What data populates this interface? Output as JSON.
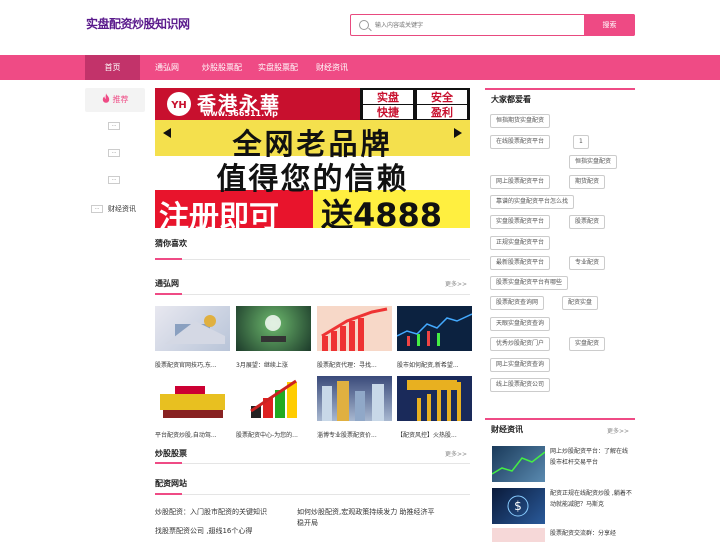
{
  "site": {
    "title": "实盘配资炒股知识网"
  },
  "search": {
    "placeholder": "输入内容或关键字",
    "button": "搜索"
  },
  "nav": [
    {
      "label": "首页"
    },
    {
      "label": "通弘网"
    },
    {
      "label": "炒股股票配"
    },
    {
      "label": "实盘股票配"
    },
    {
      "label": "财经资讯"
    }
  ],
  "sidebar": {
    "recommend": "推荐",
    "dots": "···",
    "category": "财经资讯"
  },
  "banner": {
    "brand_en": "www.366511.vip",
    "brand_cn": "香港永華",
    "badge1": "实盘",
    "badge2": "安全",
    "badge3": "快捷",
    "badge4": "盈利",
    "line1": "全网老品牌",
    "line2": "值得您的信赖",
    "line3": "注册即可",
    "line4": "送4888"
  },
  "sections": {
    "guess": "猜你喜欢",
    "tonghong": "通弘网",
    "more": "更多>>",
    "chaogu": "炒股股票",
    "peizi": "配资网站"
  },
  "thumbs": [
    {
      "caption": "股票配资官网技巧,东..."
    },
    {
      "caption": "3月展望：继续上涨"
    },
    {
      "caption": "股票配资代理：寻找..."
    },
    {
      "caption": "股市如何配资,新希望..."
    },
    {
      "caption": "平台配资炒股,自动驾..."
    },
    {
      "caption": "股票配资中心-为您的..."
    },
    {
      "caption": "淄博专业股票配资价..."
    },
    {
      "caption": "【配资风控】火热股..."
    }
  ],
  "articles": [
    {
      "title": "炒股配资：入门股市配资的关键知识"
    },
    {
      "title": "如何炒股配资,宏观政策持续发力 助推经济平稳开局"
    },
    {
      "title": "找股票配资公司 ,翅线16个心得"
    }
  ],
  "popular": {
    "title": "大家都爱看",
    "tags": [
      "恒指期货实盘配资",
      "在线股票配资平台",
      "1",
      "恒指实盘配资",
      "网上股票配资平台",
      "期货配资",
      "靠谱的实盘配资平台怎么找",
      "实盘股票配资平台",
      "股票配资",
      "正规实盘配资平台",
      "最新股票配资平台",
      "专业配资",
      "股票实盘配资平台有哪些",
      "股票配资查询网",
      "配资实盘",
      "天眼实盘配资查询",
      "优秀炒股配资门户",
      "实盘配资",
      "网上实盘配资查询",
      "线上股票配资公司"
    ]
  },
  "finance": {
    "title": "财经资讯",
    "more": "更多>>",
    "items": [
      {
        "title": "网上炒股配资平台：了解在线股市杠杆交易平台"
      },
      {
        "title": "配资正规在线配资炒股 ,躺着不动就能减肥？马斯克"
      },
      {
        "title": "股票配资交流群：分享经"
      }
    ]
  }
}
